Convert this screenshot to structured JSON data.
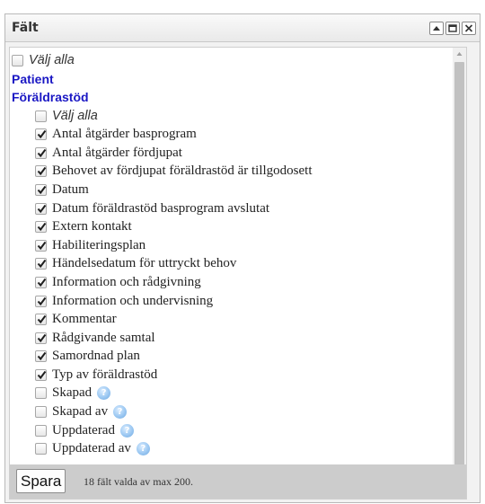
{
  "panel": {
    "title": "Fält",
    "buttons": [
      "collapse",
      "maximize",
      "close"
    ]
  },
  "items": [
    {
      "type": "checkbox",
      "label": "Välj alla",
      "checked": false,
      "italic": true,
      "indent": false,
      "info": false
    },
    {
      "type": "heading",
      "label": "Patient"
    },
    {
      "type": "heading",
      "label": "Föräldrastöd"
    },
    {
      "type": "checkbox",
      "label": "Välj alla",
      "checked": false,
      "italic": true,
      "indent": true,
      "info": false
    },
    {
      "type": "checkbox",
      "label": "Antal åtgärder basprogram",
      "checked": true,
      "indent": true,
      "info": false
    },
    {
      "type": "checkbox",
      "label": "Antal åtgärder fördjupat",
      "checked": true,
      "indent": true,
      "info": false
    },
    {
      "type": "checkbox",
      "label": "Behovet av fördjupat föräldrastöd är tillgodosett",
      "checked": true,
      "indent": true,
      "info": false
    },
    {
      "type": "checkbox",
      "label": "Datum",
      "checked": true,
      "indent": true,
      "info": false
    },
    {
      "type": "checkbox",
      "label": "Datum föräldrastöd basprogram avslutat",
      "checked": true,
      "indent": true,
      "info": false
    },
    {
      "type": "checkbox",
      "label": "Extern kontakt",
      "checked": true,
      "indent": true,
      "info": false
    },
    {
      "type": "checkbox",
      "label": "Habiliteringsplan",
      "checked": true,
      "indent": true,
      "info": false
    },
    {
      "type": "checkbox",
      "label": "Händelsedatum för uttryckt behov",
      "checked": true,
      "indent": true,
      "info": false
    },
    {
      "type": "checkbox",
      "label": "Information och rådgivning",
      "checked": true,
      "indent": true,
      "info": false
    },
    {
      "type": "checkbox",
      "label": "Information och undervisning",
      "checked": true,
      "indent": true,
      "info": false
    },
    {
      "type": "checkbox",
      "label": "Kommentar",
      "checked": true,
      "indent": true,
      "info": false
    },
    {
      "type": "checkbox",
      "label": "Rådgivande samtal",
      "checked": true,
      "indent": true,
      "info": false
    },
    {
      "type": "checkbox",
      "label": "Samordnad plan",
      "checked": true,
      "indent": true,
      "info": false
    },
    {
      "type": "checkbox",
      "label": "Typ av föräldrastöd",
      "checked": true,
      "indent": true,
      "info": false
    },
    {
      "type": "checkbox",
      "label": "Skapad",
      "checked": false,
      "indent": true,
      "info": true
    },
    {
      "type": "checkbox",
      "label": "Skapad av",
      "checked": false,
      "indent": true,
      "info": true
    },
    {
      "type": "checkbox",
      "label": "Uppdaterad",
      "checked": false,
      "indent": true,
      "info": true
    },
    {
      "type": "checkbox",
      "label": "Uppdaterad av",
      "checked": false,
      "indent": true,
      "info": true
    }
  ],
  "footer": {
    "save_label": "Spara",
    "status_text": "18 fält valda av max 200."
  },
  "icons": {
    "info": "info-icon",
    "checkmark": "checkmark-icon"
  },
  "colors": {
    "heading": "#1a17c4",
    "footer_bg": "#cccccc"
  }
}
